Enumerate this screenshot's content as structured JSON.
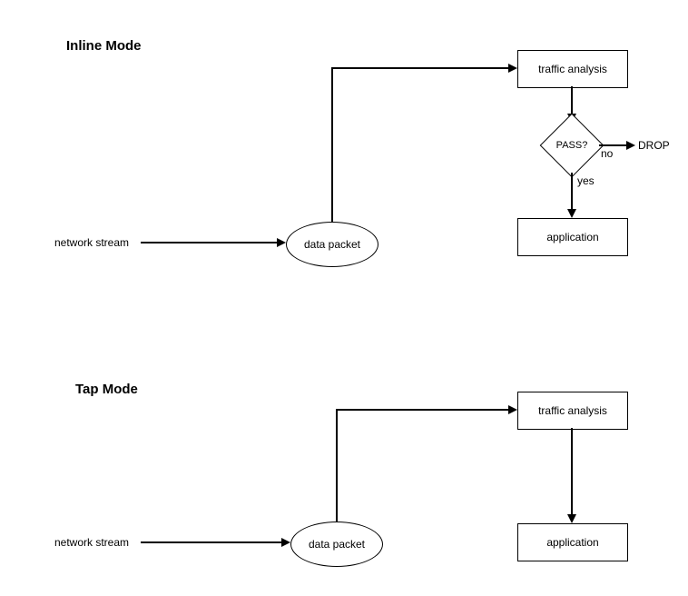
{
  "inline": {
    "title": "Inline Mode",
    "networkStream": "network stream",
    "dataPacket": "data packet",
    "trafficAnalysis": "traffic analysis",
    "pass": "PASS?",
    "no": "no",
    "drop": "DROP",
    "yes": "yes",
    "application": "application"
  },
  "tap": {
    "title": "Tap Mode",
    "networkStream": "network stream",
    "dataPacket": "data packet",
    "trafficAnalysis": "traffic analysis",
    "application": "application"
  }
}
